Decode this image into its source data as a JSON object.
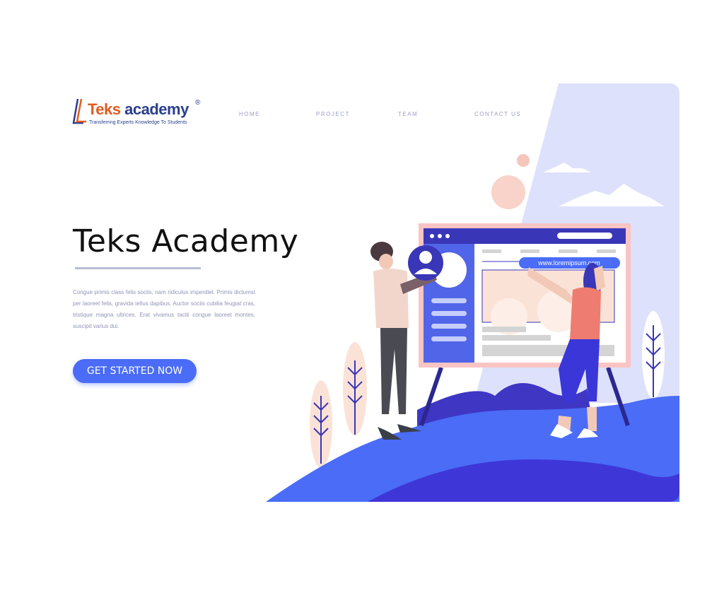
{
  "brand": {
    "name_part1": "Teks",
    "name_part2": " academy",
    "tagline": "Transferring Experts Knowledge To Students",
    "registered": "®"
  },
  "nav": {
    "items": [
      {
        "label": "HOME"
      },
      {
        "label": "PROJECT"
      },
      {
        "label": "TEAM"
      },
      {
        "label": "CONTACT US"
      }
    ]
  },
  "hero": {
    "title": "Teks Academy",
    "body": "Congue primis class felis sociis, nam ridiculus imperdiet. Primis dictumst per laoreet felis, gravida tellus dapibus. Auctor sociis cubilia feugiat cras, tristique magna ultrices. Erat vivamus taciti congue laoreet montes, suscipit varius dui.",
    "cta_label": "GET STARTED NOW"
  },
  "illustration": {
    "url_text": "www.loremipsum.com"
  },
  "colors": {
    "accent": "#4a6cf7",
    "brand_orange": "#e35b1f",
    "brand_navy": "#2a3f8c",
    "screen_pink": "#f9c4c4",
    "panel_blue": "#5165e9",
    "bg_lavender": "#dde1fb"
  }
}
